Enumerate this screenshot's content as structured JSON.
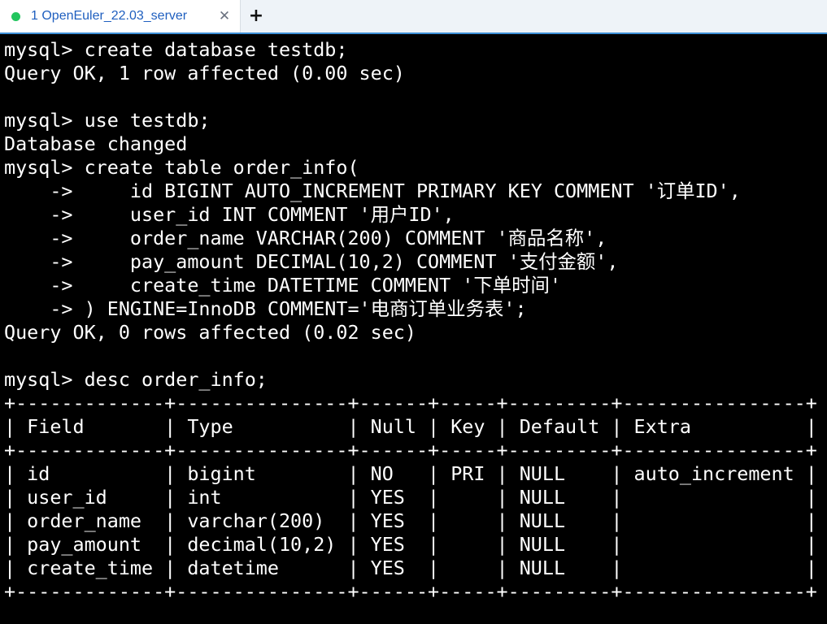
{
  "tab": {
    "title": "1 OpenEuler_22.03_server",
    "close_glyph": "✕",
    "new_glyph": "+"
  },
  "colors": {
    "status_dot": "#22c55e",
    "tab_text": "#1f5fbf",
    "accent": "#3c8fd6",
    "terminal_bg": "#000000",
    "terminal_fg": "#ffffff"
  },
  "terminal": {
    "lines": [
      "mysql> create database testdb;",
      "Query OK, 1 row affected (0.00 sec)",
      "",
      "mysql> use testdb;",
      "Database changed",
      "mysql> create table order_info(",
      "    ->     id BIGINT AUTO_INCREMENT PRIMARY KEY COMMENT '订单ID',",
      "    ->     user_id INT COMMENT '用户ID',",
      "    ->     order_name VARCHAR(200) COMMENT '商品名称',",
      "    ->     pay_amount DECIMAL(10,2) COMMENT '支付金额',",
      "    ->     create_time DATETIME COMMENT '下单时间'",
      "    -> ) ENGINE=InnoDB COMMENT='电商订单业务表';",
      "Query OK, 0 rows affected (0.02 sec)",
      "",
      "mysql> desc order_info;",
      "+-------------+---------------+------+-----+---------+----------------+",
      "| Field       | Type          | Null | Key | Default | Extra          |",
      "+-------------+---------------+------+-----+---------+----------------+",
      "| id          | bigint        | NO   | PRI | NULL    | auto_increment |",
      "| user_id     | int           | YES  |     | NULL    |                |",
      "| order_name  | varchar(200)  | YES  |     | NULL    |                |",
      "| pay_amount  | decimal(10,2) | YES  |     | NULL    |                |",
      "| create_time | datetime      | YES  |     | NULL    |                |",
      "+-------------+---------------+------+-----+---------+----------------+"
    ]
  }
}
